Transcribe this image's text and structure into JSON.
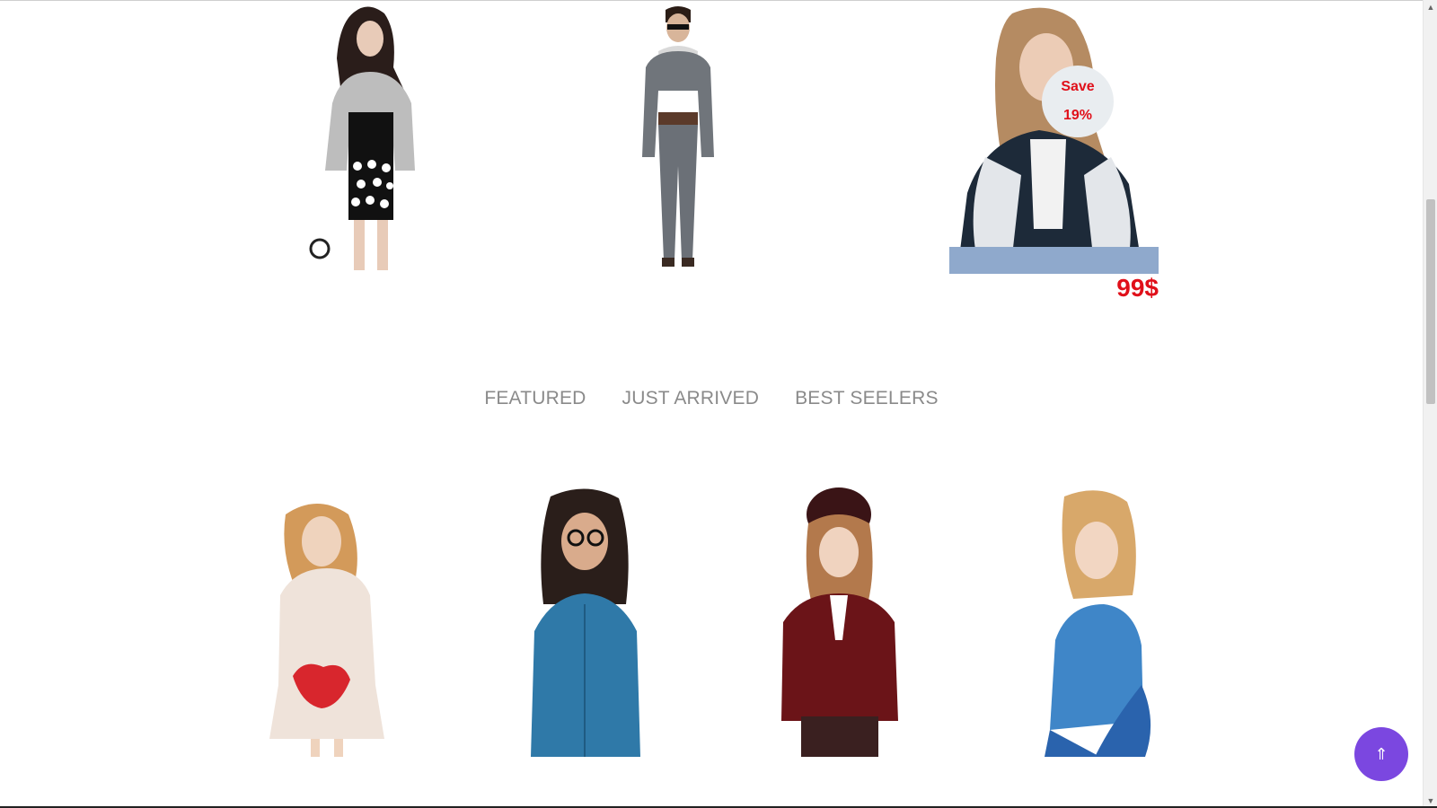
{
  "top_products": [
    {
      "name": "product-1"
    },
    {
      "name": "product-2"
    },
    {
      "name": "product-3",
      "badge": {
        "line1": "Save",
        "line2": "19%"
      },
      "price": "99$"
    }
  ],
  "tabs": [
    "FEATURED",
    "JUST ARRIVED",
    "BEST SEELERS"
  ],
  "back_to_top": {
    "icon": "double-arrow-up-icon",
    "glyph": "⇑"
  },
  "colors": {
    "accent_red": "#e0101a",
    "back_to_top": "#7b47e0"
  }
}
